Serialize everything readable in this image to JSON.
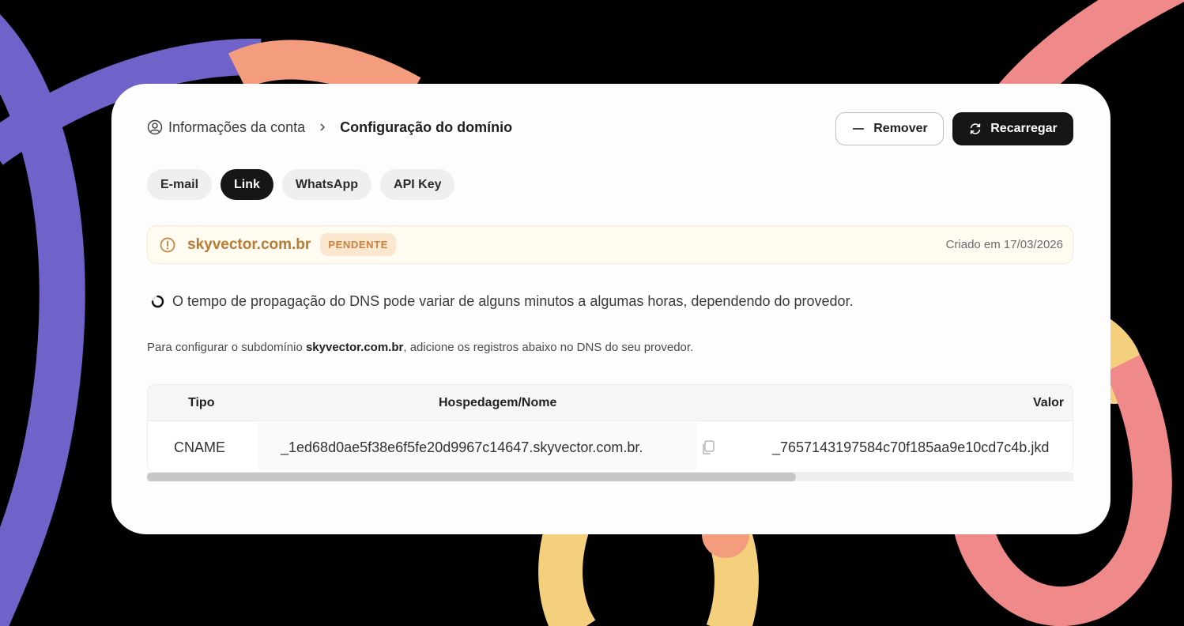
{
  "colors": {
    "background": "#000000",
    "card": "#fdfdfd",
    "accent_dark": "#161616",
    "pending_text": "#b97a32",
    "pending_badge_bg": "#fbe6cf",
    "deco_purple": "#6f63c9",
    "deco_orange": "#f39c7e",
    "deco_pink": "#f08a8a",
    "deco_yellow": "#f4d07d"
  },
  "breadcrumb": {
    "root_icon": "user-circle-icon",
    "root": "Informações da conta",
    "separator_icon": "chevron-right-icon",
    "current": "Configuração do domínio"
  },
  "actions": {
    "remove": {
      "label": "Remover",
      "icon": "minus-icon"
    },
    "reload": {
      "label": "Recarregar",
      "icon": "refresh-icon"
    }
  },
  "tabs": [
    {
      "label": "E-mail",
      "active": false
    },
    {
      "label": "Link",
      "active": true
    },
    {
      "label": "WhatsApp",
      "active": false
    },
    {
      "label": "API Key",
      "active": false
    }
  ],
  "domain": {
    "icon": "alert-circle-icon",
    "name": "skyvector.com.br",
    "status": "PENDENTE",
    "created": "Criado em 17/03/2026"
  },
  "info": {
    "icon": "spinner-icon",
    "text": "O tempo de propagação do DNS pode variar de alguns minutos a algumas horas, dependendo do provedor."
  },
  "hint": {
    "before": "Para configurar o subdomínio ",
    "domain": "skyvector.com.br",
    "after": ", adicione os registros abaixo no DNS do seu provedor."
  },
  "table": {
    "headers": {
      "type": "Tipo",
      "host": "Hospedagem/Nome",
      "value": "Valor"
    },
    "rows": [
      {
        "type": "CNAME",
        "host": "_1ed68d0ae5f38e6f5fe20d9967c14647.skyvector.com.br.",
        "value": "_7657143197584c70f185aa9e10cd7c4b.jkd",
        "copy_icon": "copy-icon"
      }
    ],
    "scroll_position": 0
  }
}
